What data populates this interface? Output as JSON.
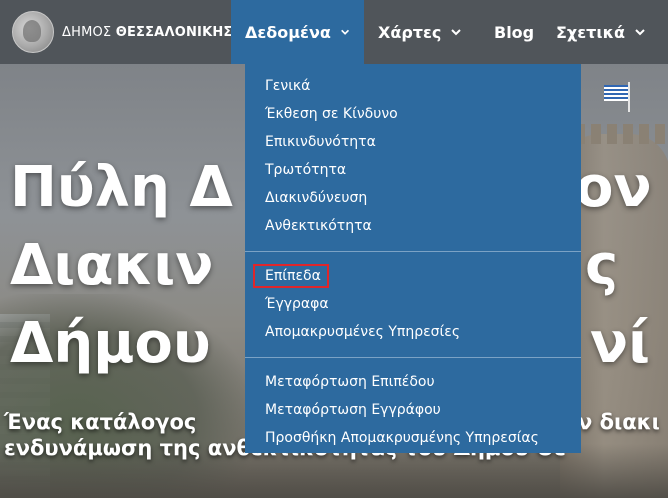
{
  "brand": {
    "logo_icon": "city-seal-logo-icon",
    "text_part1": "ΔΗΜΟΣ",
    "text_part2": "ΘΕΣΣΑΛΟΝΙΚΗΣ"
  },
  "nav": {
    "items": [
      {
        "label": "Δεδομένα",
        "has_dropdown": true,
        "active": true
      },
      {
        "label": "Χάρτες",
        "has_dropdown": true,
        "active": false
      },
      {
        "label": "Blog",
        "has_dropdown": false,
        "active": false
      },
      {
        "label": "Σχετικά",
        "has_dropdown": true,
        "active": false
      }
    ]
  },
  "dropdown": {
    "group1": [
      "Γενικά",
      "Έκθεση σε Κίνδυνο",
      "Επικινδυνότητα",
      "Τρωτότητα",
      "Διακινδύνευση",
      "Ανθεκτικότητα"
    ],
    "group2": [
      "Επίπεδα",
      "Έγγραφα",
      "Απομακρυσμένες Υπηρεσίες"
    ],
    "group3": [
      "Μεταφόρτωση Επιπέδου",
      "Μεταφόρτωση Εγγράφου",
      "Προσθήκη Απομακρυσμένης Υπηρεσίας"
    ],
    "highlighted_item": "Επίπεδα",
    "highlight_color": "#e0262b"
  },
  "hero": {
    "title_line1": "Πύλη Δ",
    "title_line1_right": "ον",
    "title_line2": "Διακιν",
    "title_line2_right": "ς",
    "title_line3": "Δήμου",
    "title_line3_right": "νί",
    "subtitle_line1_left": "Ένας κατάλογος",
    "subtitle_line1_right": "ν διακι",
    "subtitle_line2": "ενδυνάμωση της ανθεκτικότητας του Δήμου Θε"
  },
  "colors": {
    "nav_bg": "#50555a",
    "accent": "#2d6a9f",
    "text": "#ffffff"
  }
}
